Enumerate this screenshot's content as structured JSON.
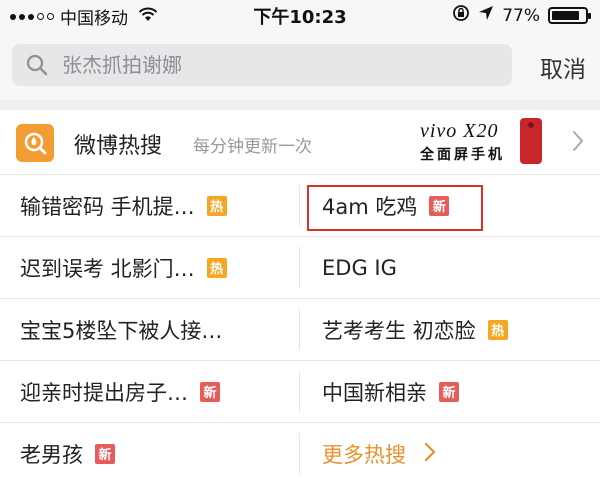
{
  "status_bar": {
    "carrier": "中国移动",
    "time": "下午10:23",
    "battery": "77%",
    "battery_level": 0.77
  },
  "search": {
    "placeholder": "张杰抓拍谢娜",
    "cancel_label": "取消"
  },
  "hot_search": {
    "title": "微博热搜",
    "subtitle": "每分钟更新一次",
    "ad": {
      "brand": "vivo X20",
      "slogan": "全面屏手机"
    }
  },
  "items": [
    {
      "left": {
        "label": "输错密码 手机提…",
        "badge": "热",
        "badge_type": "hot"
      },
      "right": {
        "label": "4am 吃鸡",
        "badge": "新",
        "badge_type": "new",
        "highlighted": true
      }
    },
    {
      "left": {
        "label": "迟到误考 北影门…",
        "badge": "热",
        "badge_type": "hot"
      },
      "right": {
        "label": "EDG IG",
        "badge": "",
        "badge_type": ""
      }
    },
    {
      "left": {
        "label": "宝宝5楼坠下被人接…",
        "badge": "",
        "badge_type": ""
      },
      "right": {
        "label": "艺考考生 初恋脸",
        "badge": "热",
        "badge_type": "hot"
      }
    },
    {
      "left": {
        "label": "迎亲时提出房子…",
        "badge": "新",
        "badge_type": "new"
      },
      "right": {
        "label": "中国新相亲",
        "badge": "新",
        "badge_type": "new"
      }
    },
    {
      "left": {
        "label": "老男孩",
        "badge": "新",
        "badge_type": "new"
      },
      "right": {
        "label": "更多热搜",
        "badge": "",
        "badge_type": "",
        "is_more": true
      }
    }
  ],
  "colors": {
    "accent_orange": "#f39c32",
    "hot_badge": "#f5a623",
    "new_badge": "#e45c5c",
    "highlight_border": "#d9302c",
    "more_link": "#e8912b"
  },
  "icons": {
    "search": "search-icon",
    "logo": "weibo-hot-search-logo-icon",
    "chevron": "chevron-right-icon",
    "wifi": "wifi-icon",
    "lock": "orientation-lock-icon",
    "location": "location-arrow-icon"
  }
}
